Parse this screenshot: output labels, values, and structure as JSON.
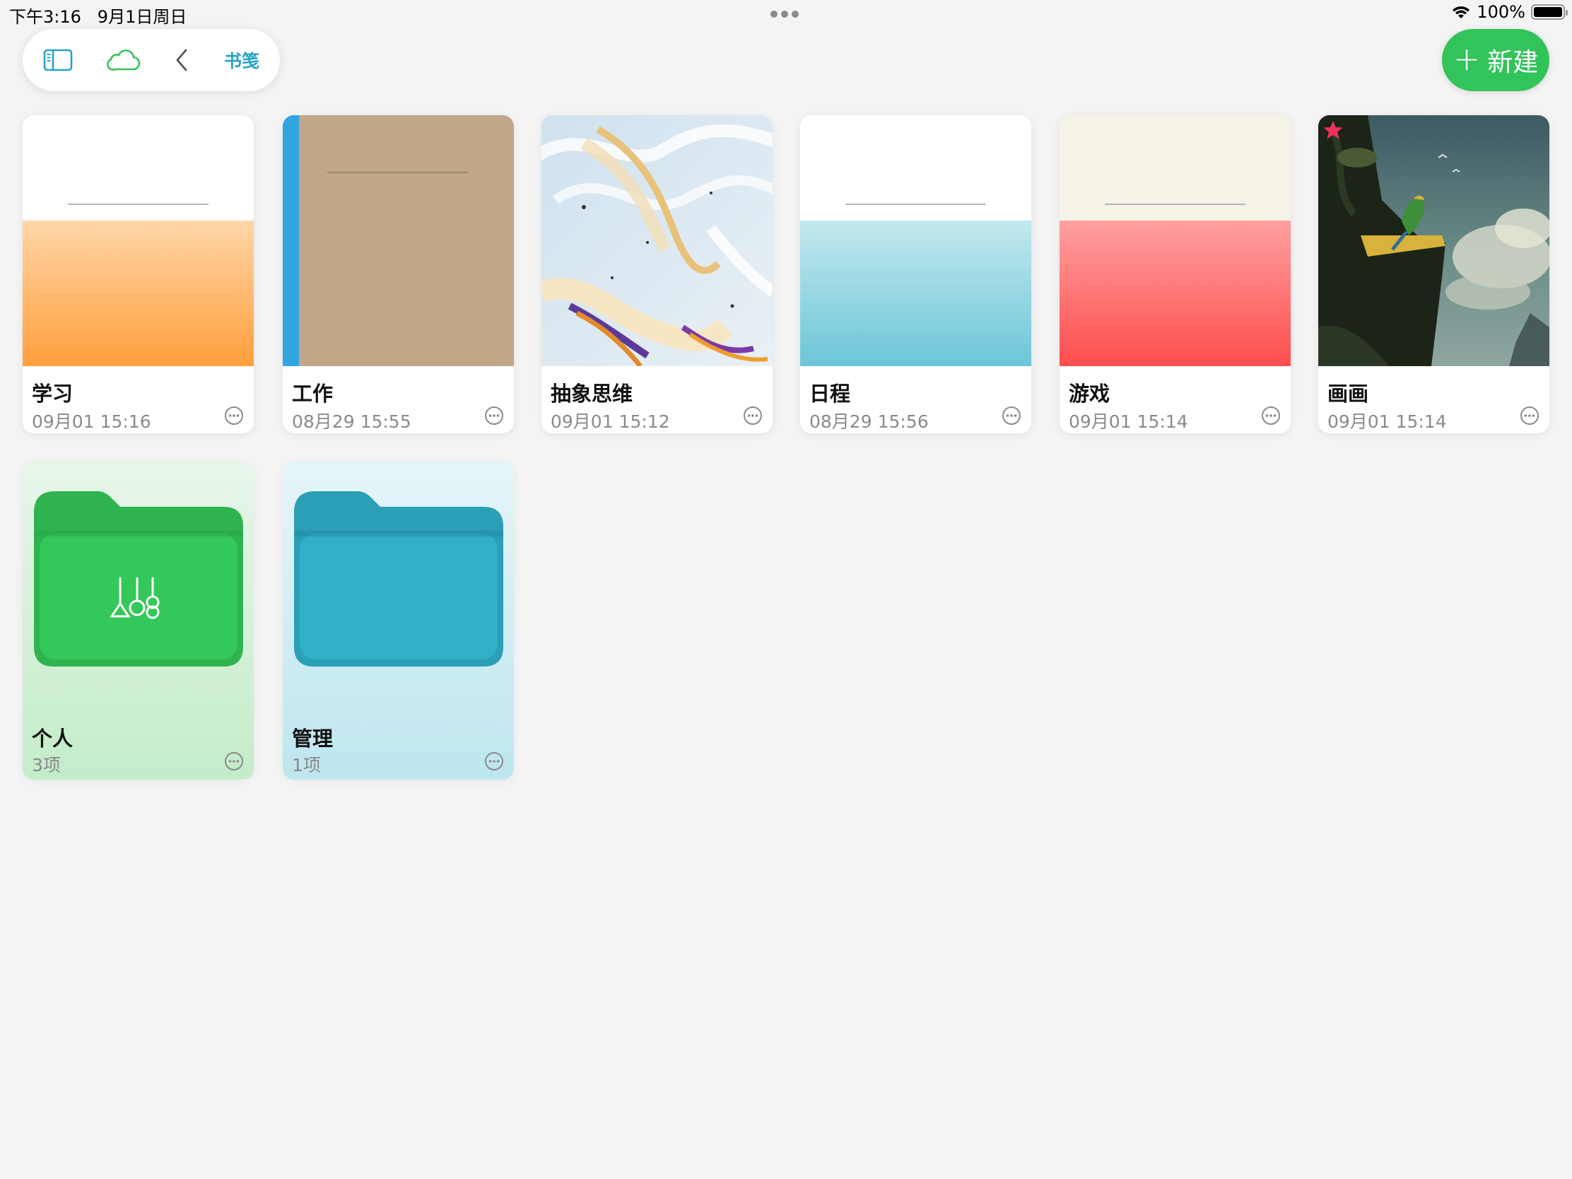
{
  "status_bar": {
    "time": "下午3:16",
    "date": "9月1日周日",
    "battery": "100%"
  },
  "toolbar": {
    "icons": [
      "sidebar-icon",
      "cloud-icon",
      "chevron-left-icon"
    ],
    "bookmark_label": "书笺",
    "accent_color": "#27a3c4",
    "cloud_color": "#33c35b"
  },
  "new_button": {
    "label": "新建",
    "icon": "plus-icon",
    "color": "#33c35b"
  },
  "notebooks": [
    {
      "title": "学习",
      "date": "09月01 15:16",
      "cover": "orange-gradient"
    },
    {
      "title": "工作",
      "date": "08月29 15:55",
      "cover": "kraft-with-blue-spine"
    },
    {
      "title": "抽象思维",
      "date": "09月01 15:12",
      "cover": "marble-abstract"
    },
    {
      "title": "日程",
      "date": "08月29 15:56",
      "cover": "teal-gradient"
    },
    {
      "title": "游戏",
      "date": "09月01 15:14",
      "cover": "red-gradient"
    },
    {
      "title": "画画",
      "date": "09月01 15:14",
      "cover": "parrot-cliff-painting",
      "starred": true
    }
  ],
  "folders": [
    {
      "title": "个人",
      "count": "3项",
      "color": "#34c759",
      "icon": "instruments-icon"
    },
    {
      "title": "管理",
      "count": "1项",
      "color": "#30b0c7"
    }
  ]
}
